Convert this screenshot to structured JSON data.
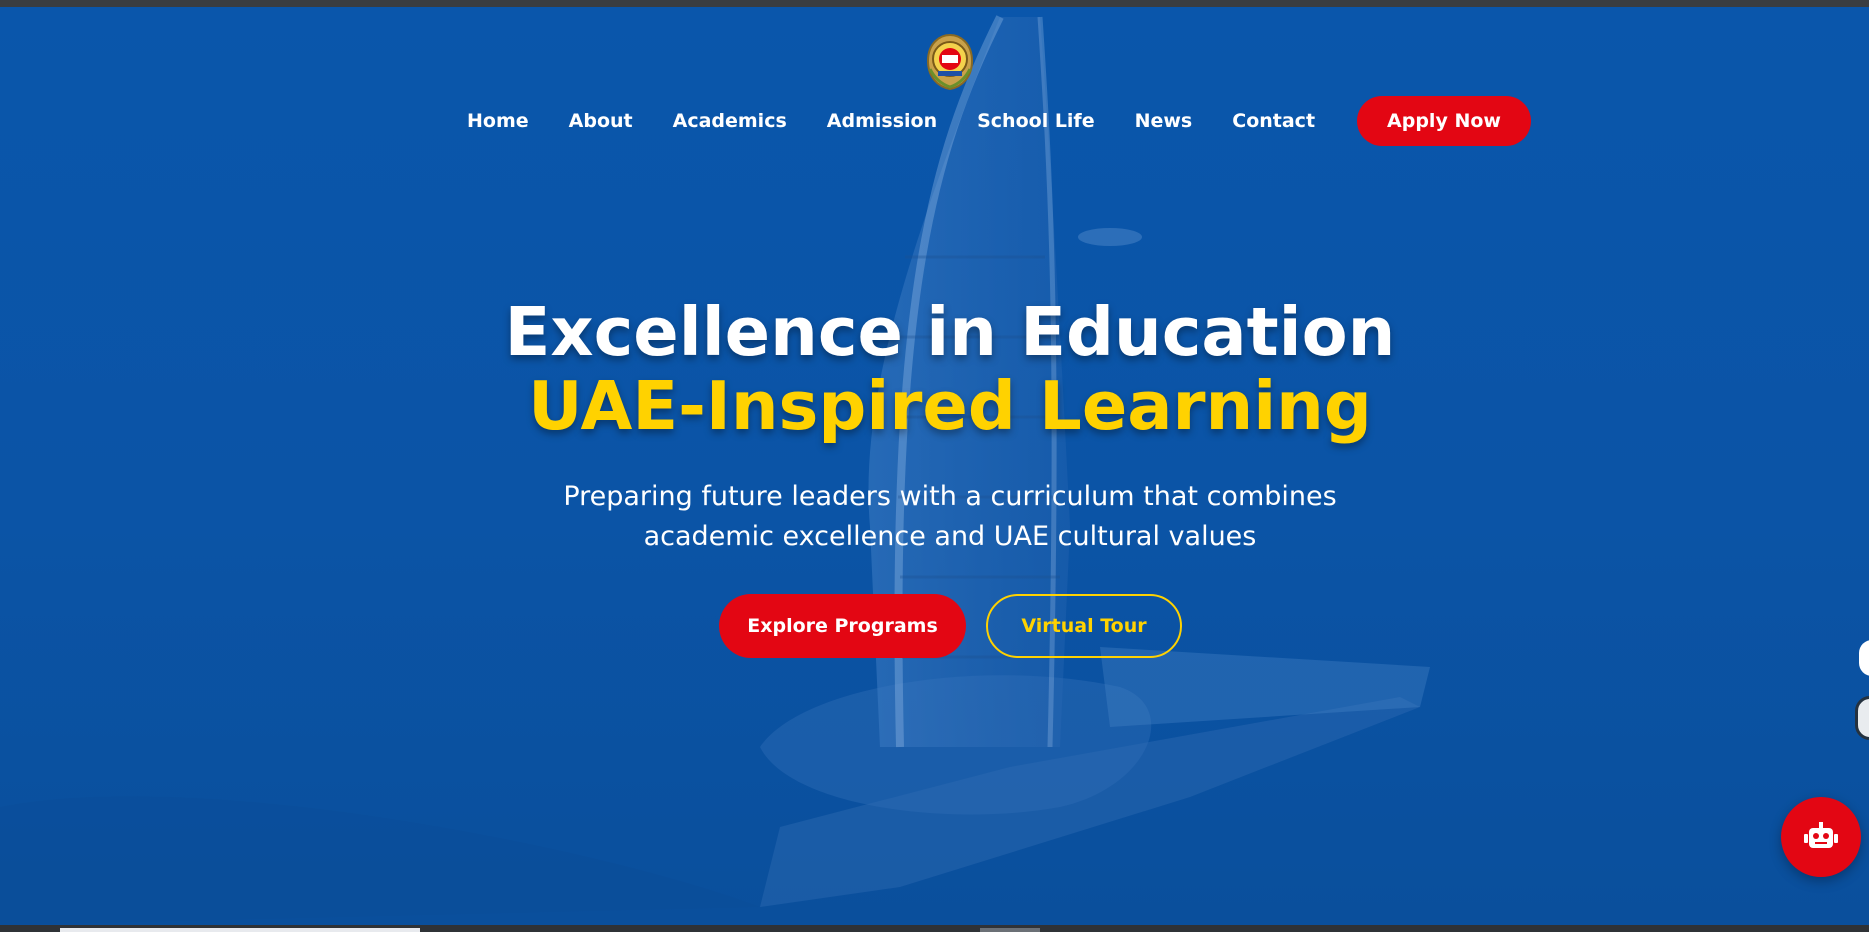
{
  "brand": {
    "logo_name": "school-crest-logo",
    "colors": {
      "primary_blue": "#0b55a8",
      "accent_red": "#e30613",
      "accent_yellow": "#ffd200",
      "text_white": "#ffffff"
    }
  },
  "nav": {
    "items": [
      {
        "label": "Home"
      },
      {
        "label": "About"
      },
      {
        "label": "Academics"
      },
      {
        "label": "Admission"
      },
      {
        "label": "School Life"
      },
      {
        "label": "News"
      },
      {
        "label": "Contact"
      }
    ],
    "apply_label": "Apply Now"
  },
  "hero": {
    "title_line1": "Excellence in Education",
    "title_line2": "UAE-Inspired Learning",
    "subtitle_line1": "Preparing future leaders with a curriculum that combines",
    "subtitle_line2": "academic excellence and UAE cultural values",
    "primary_cta": "Explore Programs",
    "secondary_cta": "Virtual Tour"
  },
  "widgets": {
    "chat_icon": "robot-icon"
  }
}
